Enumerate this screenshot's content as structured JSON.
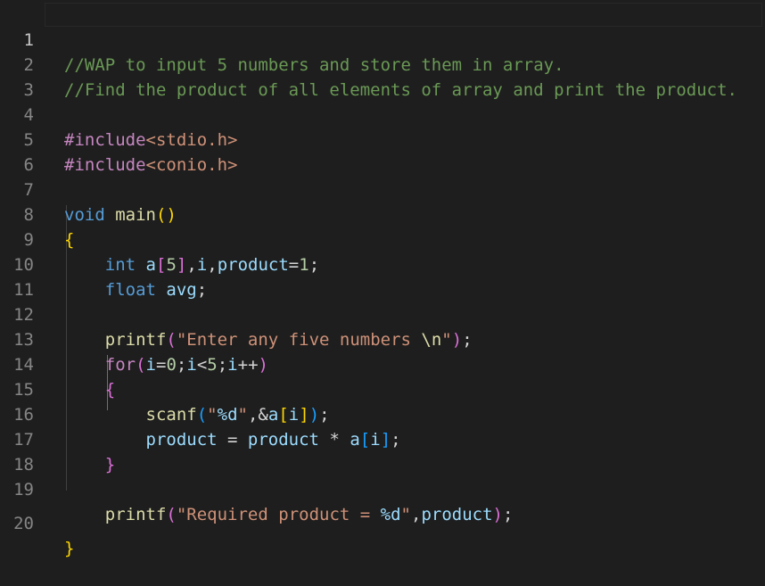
{
  "editor": {
    "colors": {
      "background": "#1e1e1e",
      "line_number": "#858585",
      "comment": "#6a9955",
      "keyword": "#569cd6",
      "preprocessor": "#c586c0",
      "function": "#dcdcaa",
      "variable": "#9cdcfe",
      "number": "#b5cea8",
      "string": "#ce9178",
      "bracket_level_1": "#ffd700",
      "bracket_level_2": "#da70d6",
      "bracket_level_3": "#179fff"
    },
    "line_numbers": [
      "1",
      "2",
      "3",
      "4",
      "5",
      "6",
      "7",
      "8",
      "9",
      "10",
      "11",
      "12",
      "13",
      "14",
      "15",
      "16",
      "17",
      "18",
      "19",
      "20"
    ],
    "lines": {
      "l1": {
        "comment": "//WAP to input 5 numbers and store them in array."
      },
      "l2": {
        "comment": "//Find the product of all elements of array and print the product."
      },
      "l4": {
        "preproc": "#include",
        "header": "<stdio.h>"
      },
      "l5": {
        "preproc": "#include",
        "header": "<conio.h>"
      },
      "l7": {
        "keyword": "void",
        "sp": " ",
        "func": "main",
        "open": "(",
        "close": ")"
      },
      "l8": {
        "brace": "{"
      },
      "l9": {
        "indent": "    ",
        "keyword": "int",
        "sp": " ",
        "var_a": "a",
        "br_open": "[",
        "num5": "5",
        "br_close": "]",
        "comma1": ",",
        "var_i": "i",
        "comma2": ",",
        "var_product": "product",
        "eq": "=",
        "num1": "1",
        "semi": ";"
      },
      "l10": {
        "indent": "    ",
        "keyword": "float",
        "sp": " ",
        "var_avg": "avg",
        "semi": ";"
      },
      "l12": {
        "indent": "    ",
        "func": "printf",
        "open": "(",
        "str": "\"Enter any five numbers ",
        "escape": "\\n",
        "str_end": "\"",
        "close": ")",
        "semi": ";"
      },
      "l13": {
        "indent": "    ",
        "keyword": "for",
        "open": "(",
        "var_i1": "i",
        "eq": "=",
        "num0": "0",
        "semi1": ";",
        "var_i2": "i",
        "lt": "<",
        "num5": "5",
        "semi2": ";",
        "var_i3": "i",
        "inc": "++",
        "close": ")"
      },
      "l14": {
        "indent": "    ",
        "brace": "{"
      },
      "l15": {
        "indent": "        ",
        "func": "scanf",
        "open": "(",
        "str": "\"",
        "fmt": "%d",
        "str_end": "\"",
        "comma": ",",
        "amp": "&",
        "var_a": "a",
        "br_open": "[",
        "var_i": "i",
        "br_close": "]",
        "close": ")",
        "semi": ";"
      },
      "l16": {
        "indent": "        ",
        "var_product1": "product",
        "eq": " = ",
        "var_product2": "product",
        "mul": " * ",
        "var_a": "a",
        "br_open": "[",
        "var_i": "i",
        "br_close": "]",
        "semi": ";"
      },
      "l17": {
        "indent": "    ",
        "brace": "}"
      },
      "l19": {
        "indent": "    ",
        "func": "printf",
        "open": "(",
        "str": "\"Required product = ",
        "fmt": "%d",
        "str_end": "\"",
        "comma": ",",
        "var_product": "product",
        "close": ")",
        "semi": ";"
      },
      "l20": {
        "brace": "}"
      }
    }
  }
}
